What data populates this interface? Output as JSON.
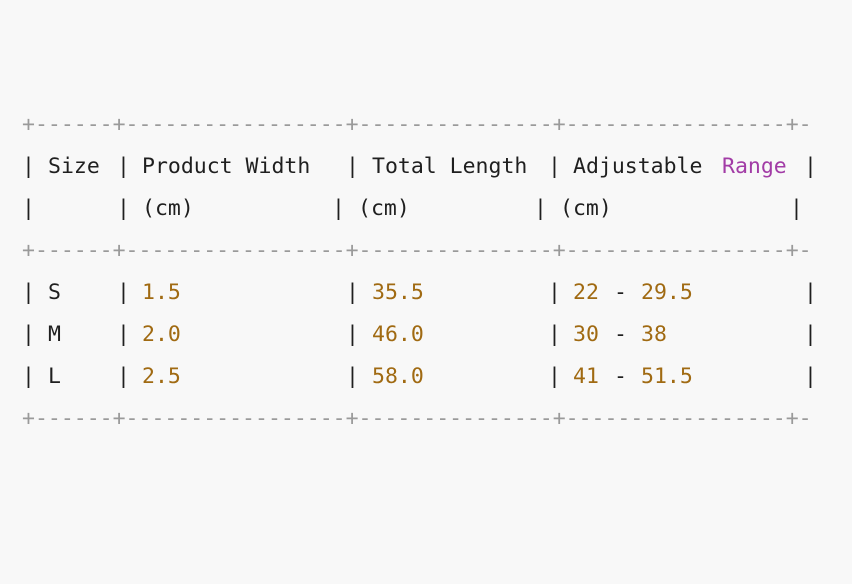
{
  "border": "+------+-----------------+---------------+-----------------+-",
  "header": {
    "line1": {
      "size": "Size",
      "width": "Product Width",
      "length": "Total Length",
      "adjustable": "Adjustable",
      "range": "Range"
    },
    "line2": {
      "width_unit": "(cm)",
      "length_unit": "(cm)",
      "adjustable_unit": "(cm)"
    }
  },
  "rows": [
    {
      "size": "S",
      "width": "1.5",
      "length": "35.5",
      "range_min": "22",
      "range_dash": "-",
      "range_max": "29.5"
    },
    {
      "size": "M",
      "width": "2.0",
      "length": "46.0",
      "range_min": "30",
      "range_dash": "-",
      "range_max": "38"
    },
    {
      "size": "L",
      "width": "2.5",
      "length": "58.0",
      "range_min": "41",
      "range_dash": "-",
      "range_max": "51.5"
    }
  ],
  "colors": {
    "background": "#f8f8f8",
    "text": "#1f1f1f",
    "border": "#9a9a9a",
    "number": "#a06a12",
    "keyword": "#a23ca6"
  }
}
